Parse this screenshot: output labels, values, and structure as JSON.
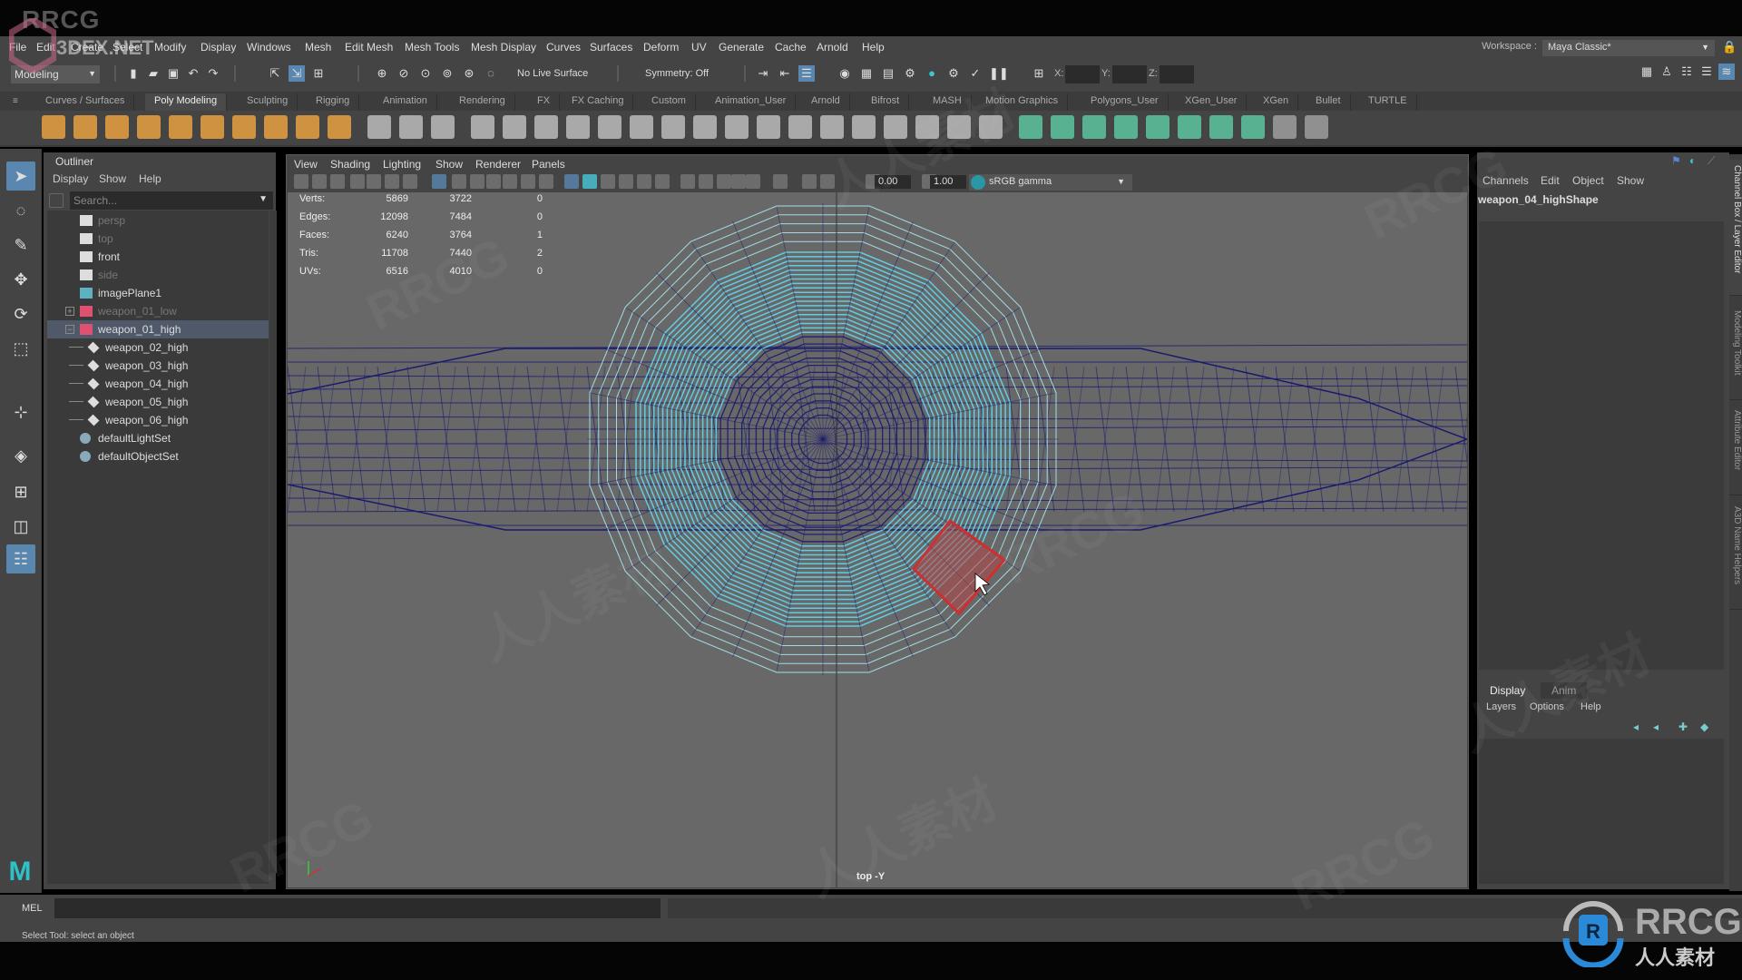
{
  "watermarks": {
    "top_left": "RRCG",
    "site": "3DEX.NET",
    "repeat": "RRCG",
    "repeat_cn": "人人素材",
    "logo_text": "RRCG",
    "logo_sub": "人人素材"
  },
  "menubar": {
    "items": [
      "File",
      "Edit",
      "Create",
      "Select",
      "Modify",
      "Display",
      "Windows",
      "Mesh",
      "Edit Mesh",
      "Mesh Tools",
      "Mesh Display",
      "Curves",
      "Surfaces",
      "Deform",
      "UV",
      "Generate",
      "Cache",
      "Arnold",
      "Help"
    ]
  },
  "workspace": {
    "label": "Workspace :",
    "value": "Maya Classic*"
  },
  "statusline": {
    "mode": "Modeling",
    "live_surface": "No Live Surface",
    "symmetry": "Symmetry: Off",
    "x_label": "X:",
    "y_label": "Y:",
    "z_label": "Z:",
    "x_value": "",
    "y_value": "",
    "z_value": ""
  },
  "shelf_tabs": [
    {
      "label": "Curves / Surfaces",
      "active": false
    },
    {
      "label": "Poly Modeling",
      "active": true
    },
    {
      "label": "Sculpting",
      "active": false
    },
    {
      "label": "Rigging",
      "active": false
    },
    {
      "label": "Animation",
      "active": false
    },
    {
      "label": "Rendering",
      "active": false
    },
    {
      "label": "FX",
      "active": false
    },
    {
      "label": "FX Caching",
      "active": false
    },
    {
      "label": "Custom",
      "active": false
    },
    {
      "label": "Animation_User",
      "active": false
    },
    {
      "label": "Arnold",
      "active": false
    },
    {
      "label": "Bifrost",
      "active": false
    },
    {
      "label": "MASH",
      "active": false
    },
    {
      "label": "Motion Graphics",
      "active": false
    },
    {
      "label": "Polygons_User",
      "active": false
    },
    {
      "label": "XGen_User",
      "active": false
    },
    {
      "label": "XGen",
      "active": false
    },
    {
      "label": "Bullet",
      "active": false
    },
    {
      "label": "TURTLE",
      "active": false
    }
  ],
  "colors": {
    "accent": "#5a87b0",
    "shelf_orange": "#e8a040",
    "shelf_green": "#5bbf9a",
    "maya_teal": "#2fc1c8",
    "wire_dark": "#1a1a6e",
    "wire_light": "#5fd8f0",
    "selection_red": "#cc3030"
  },
  "outliner": {
    "title": "Outliner",
    "menu": [
      "Display",
      "Show",
      "Help"
    ],
    "search_placeholder": "Search...",
    "items": [
      {
        "label": "persp",
        "icon": "camera-icon",
        "dim": true
      },
      {
        "label": "top",
        "icon": "camera-icon",
        "dim": true
      },
      {
        "label": "front",
        "icon": "camera-icon",
        "dim": false
      },
      {
        "label": "side",
        "icon": "camera-icon",
        "dim": true
      },
      {
        "label": "imagePlane1",
        "icon": "image-plane-icon",
        "dim": false
      },
      {
        "label": "weapon_01_low",
        "icon": "group-icon",
        "dim": true,
        "expand": "+"
      },
      {
        "label": "weapon_01_high",
        "icon": "group-icon",
        "dim": false,
        "expand": "−",
        "selected": true
      },
      {
        "label": "weapon_02_high",
        "icon": "mesh-icon",
        "dim": false,
        "child": true
      },
      {
        "label": "weapon_03_high",
        "icon": "mesh-icon",
        "dim": false,
        "child": true
      },
      {
        "label": "weapon_04_high",
        "icon": "mesh-icon",
        "dim": false,
        "child": true
      },
      {
        "label": "weapon_05_high",
        "icon": "mesh-icon",
        "dim": false,
        "child": true
      },
      {
        "label": "weapon_06_high",
        "icon": "mesh-icon",
        "dim": false,
        "child": true
      },
      {
        "label": "defaultLightSet",
        "icon": "set-icon",
        "dim": false
      },
      {
        "label": "defaultObjectSet",
        "icon": "set-icon",
        "dim": false
      }
    ]
  },
  "viewport": {
    "menu": [
      "View",
      "Shading",
      "Lighting",
      "Show",
      "Renderer",
      "Panels"
    ],
    "exposure": "0.00",
    "gamma": "1.00",
    "color_space": "sRGB gamma",
    "view_name": "top -Y",
    "hud": [
      {
        "label": "Verts:",
        "a": "5869",
        "b": "3722",
        "c": "0"
      },
      {
        "label": "Edges:",
        "a": "12098",
        "b": "7484",
        "c": "0"
      },
      {
        "label": "Faces:",
        "a": "6240",
        "b": "3764",
        "c": "1"
      },
      {
        "label": "Tris:",
        "a": "11708",
        "b": "7440",
        "c": "2"
      },
      {
        "label": "UVs:",
        "a": "6516",
        "b": "4010",
        "c": "0"
      }
    ]
  },
  "channelbox": {
    "menu": [
      "Channels",
      "Edit",
      "Object",
      "Show"
    ],
    "object_name": "weapon_04_highShape"
  },
  "layer_editor": {
    "tabs": [
      "Display",
      "Anim"
    ],
    "menu": [
      "Layers",
      "Options",
      "Help"
    ]
  },
  "side_tabs": [
    "Channel Box / Layer Editor",
    "Modeling Toolkit",
    "Attribute Editor",
    "A3D Name Helpers"
  ],
  "cmdline": {
    "label": "MEL",
    "value": ""
  },
  "helpline": {
    "text": "Select Tool: select an object"
  }
}
